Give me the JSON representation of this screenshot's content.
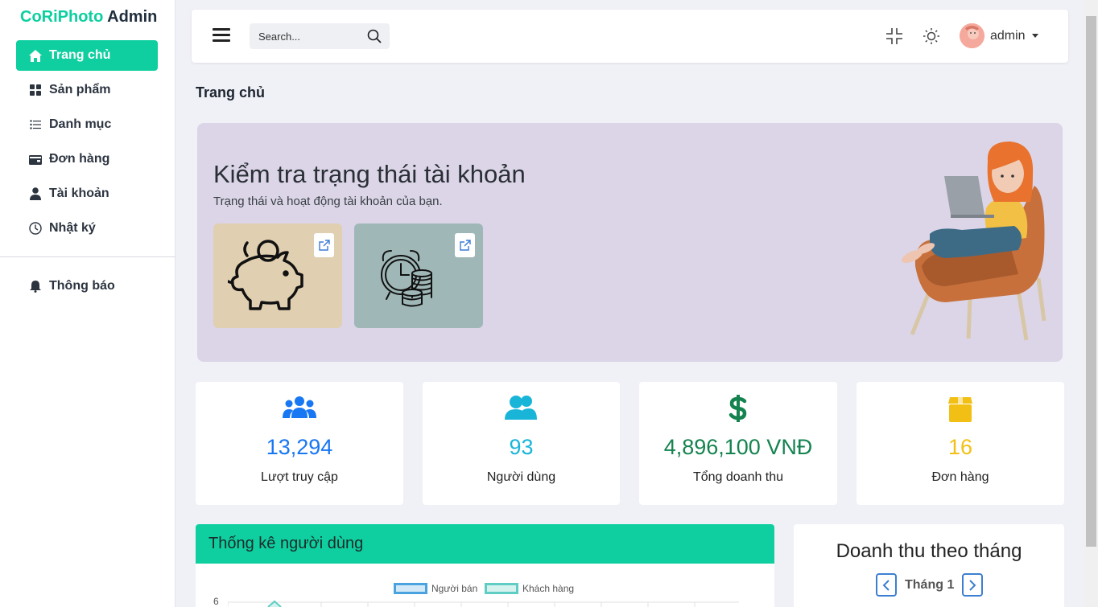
{
  "brand": {
    "part1": "CoRiPhoto",
    "part2": " Admin"
  },
  "sidebar": {
    "items": [
      {
        "label": "Trang chủ",
        "icon": "home-icon",
        "active": true
      },
      {
        "label": "Sản phẩm",
        "icon": "grid-icon"
      },
      {
        "label": "Danh mục",
        "icon": "list-icon"
      },
      {
        "label": "Đơn hàng",
        "icon": "wallet-icon"
      },
      {
        "label": "Tài khoản",
        "icon": "user-icon"
      },
      {
        "label": "Nhật ký",
        "icon": "clock-icon"
      }
    ],
    "secondary": [
      {
        "label": "Thông báo",
        "icon": "bell-icon"
      }
    ]
  },
  "topbar": {
    "search_placeholder": "Search...",
    "username": "admin"
  },
  "page": {
    "title": "Trang chủ"
  },
  "hero": {
    "title": "Kiểm tra trạng thái tài khoản",
    "subtitle": "Trạng thái và hoạt động tài khoản của bạn."
  },
  "stats": [
    {
      "value": "13,294",
      "label": "Lượt truy cập",
      "color": "#1877f2",
      "icon": "users-icon"
    },
    {
      "value": "93",
      "label": "Người dùng",
      "color": "#19b5d9",
      "icon": "user-group-icon"
    },
    {
      "value": "4,896,100 VNĐ",
      "label": "Tổng doanh thu",
      "color": "#15834f",
      "icon": "dollar-icon"
    },
    {
      "value": "16",
      "label": "Đơn hàng",
      "color": "#f2c014",
      "icon": "box-icon"
    }
  ],
  "user_chart": {
    "title": "Thống kê người dùng",
    "legend": [
      "Người bán",
      "Khách hàng"
    ],
    "y_top_tick": "6"
  },
  "revenue": {
    "title": "Doanh thu theo tháng",
    "month_label": "Tháng 1"
  },
  "colors": {
    "accent": "#0fcfa0",
    "hero_bg": "#dbd5e7"
  }
}
